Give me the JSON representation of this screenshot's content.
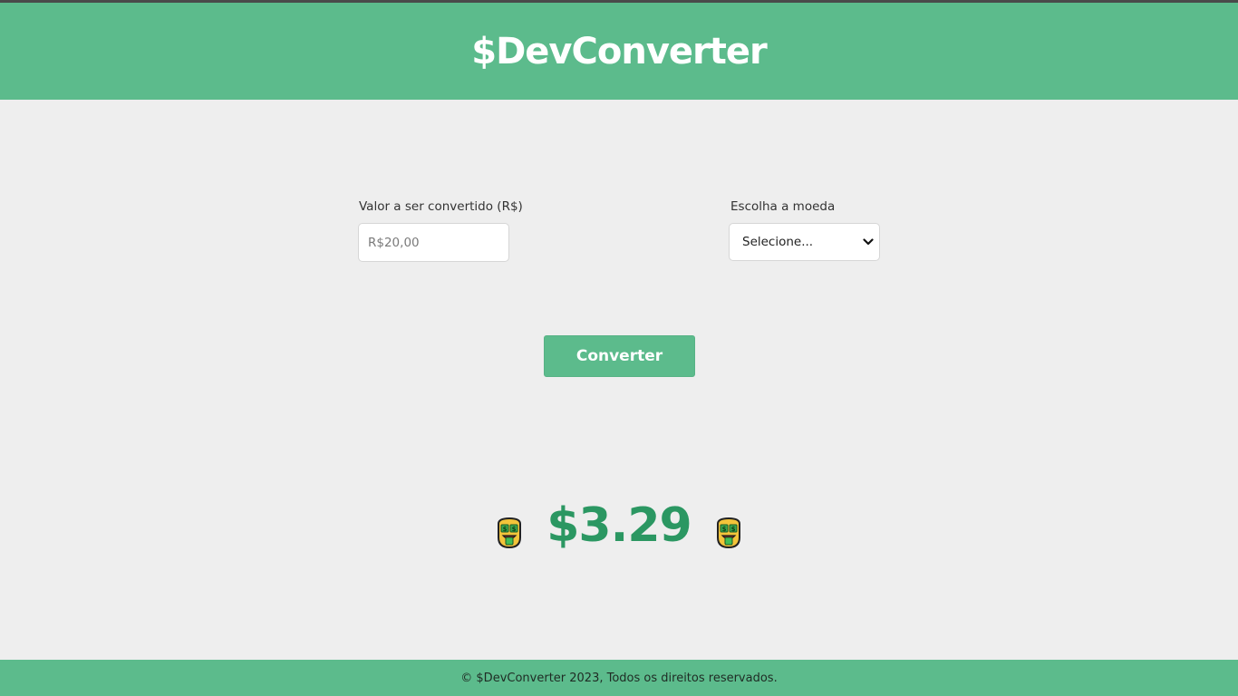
{
  "header": {
    "brand": "$DevConverter"
  },
  "form": {
    "amount_label": "Valor a ser convertido (R$)",
    "amount_placeholder": "R$20,00",
    "amount_value": "",
    "currency_label": "Escolha a moeda",
    "currency_selected": "Selecione...",
    "convert_label": "Converter"
  },
  "result": {
    "value": "$3.29",
    "left_icon": "money-mouth-face-icon",
    "right_icon": "money-mouth-face-icon"
  },
  "footer": {
    "text": "© $DevConverter 2023, Todos os direitos reservados."
  },
  "colors": {
    "brand_green": "#5cbb8c",
    "result_green": "#2b9762",
    "background": "#eeeeee"
  }
}
